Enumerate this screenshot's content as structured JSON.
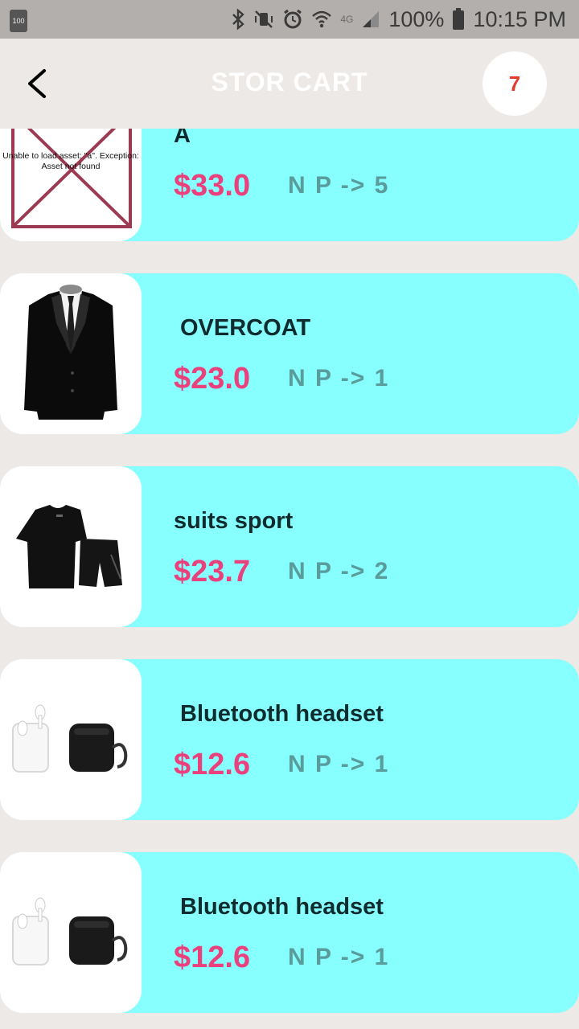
{
  "status_bar": {
    "battery_small": "100",
    "battery": "100%",
    "time": "10:15 PM",
    "network": "4G"
  },
  "app_bar": {
    "title": "STOR CART",
    "cart_count": "7"
  },
  "items": [
    {
      "name": "A",
      "price": "$33.0",
      "quantity": "N P -> 5",
      "image": "asset-error",
      "image_error": "Unable to load asset: \"a\". Exception: Asset not found"
    },
    {
      "name": "OVERCOAT",
      "price": "$23.0",
      "quantity": "N P -> 1",
      "image": "suit-jacket"
    },
    {
      "name": "suits sport",
      "price": "$23.7",
      "quantity": "N P -> 2",
      "image": "sport-suit"
    },
    {
      "name": "Bluetooth headset",
      "price": "$12.6",
      "quantity": "N P -> 1",
      "image": "earbuds-case"
    },
    {
      "name": "Bluetooth headset",
      "price": "$12.6",
      "quantity": "N P -> 1",
      "image": "earbuds-case"
    }
  ],
  "colors": {
    "card": "#86fffe",
    "price": "#ea417d",
    "quantity": "#5a9b9c",
    "badge_text": "#e53b2c"
  }
}
